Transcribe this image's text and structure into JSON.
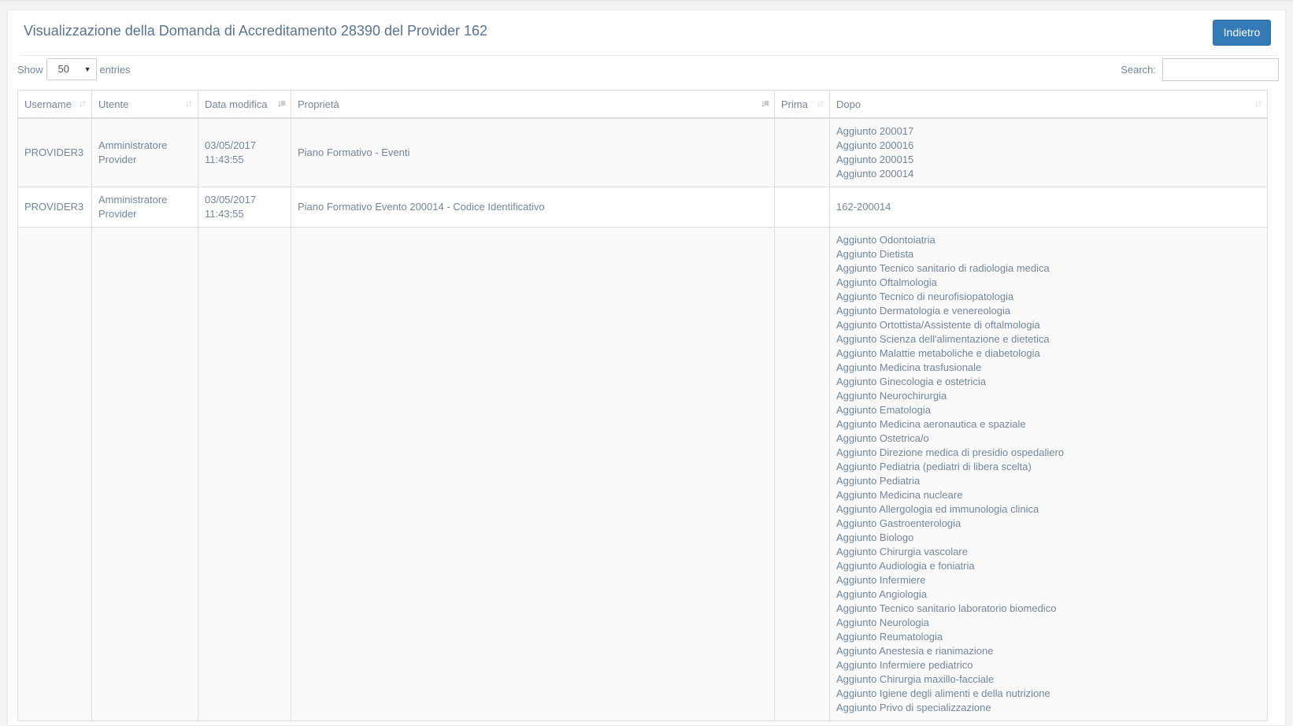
{
  "page": {
    "title": "Visualizzazione della Domanda di Accreditamento 28390 del Provider 162",
    "back_label": "Indietro"
  },
  "controls": {
    "show_label": "Show",
    "entries_value": "50",
    "entries_label": "entries",
    "search_label": "Search:",
    "search_value": ""
  },
  "table": {
    "columns": [
      "Username",
      "Utente",
      "Data modifica",
      "Proprietà",
      "Prima",
      "Dopo"
    ],
    "rows": [
      {
        "username": "PROVIDER3",
        "utente": "Amministratore Provider",
        "data": "03/05/2017 11:43:55",
        "proprieta": "Piano Formativo - Eventi",
        "prima": "",
        "dopo": [
          "Aggiunto 200017",
          "Aggiunto 200016",
          "Aggiunto 200015",
          "Aggiunto 200014"
        ]
      },
      {
        "username": "PROVIDER3",
        "utente": "Amministratore Provider",
        "data": "03/05/2017 11:43:55",
        "proprieta": "Piano Formativo Evento 200014 - Codice Identificativo",
        "prima": "",
        "dopo": [
          "162-200014"
        ]
      },
      {
        "username": "",
        "utente": "",
        "data": "",
        "proprieta": "",
        "prima": "",
        "dopo": [
          "Aggiunto Odontoiatria",
          "Aggiunto Dietista",
          "Aggiunto Tecnico sanitario di radiologia medica",
          "Aggiunto Oftalmologia",
          "Aggiunto Tecnico di neurofisiopatologia",
          "Aggiunto Dermatologia e venereologia",
          "Aggiunto Ortottista/Assistente di oftalmologia",
          "Aggiunto Scienza dell'alimentazione e dietetica",
          "Aggiunto Malattie metaboliche e diabetologia",
          "Aggiunto Medicina trasfusionale",
          "Aggiunto Ginecologia e ostetricia",
          "Aggiunto Neurochirurgia",
          "Aggiunto Ematologia",
          "Aggiunto Medicina aeronautica e spaziale",
          "Aggiunto Ostetrica/o",
          "Aggiunto Direzione medica di presidio ospedaliero",
          "Aggiunto Pediatria (pediatri di libera scelta)",
          "Aggiunto Pediatria",
          "Aggiunto Medicina nucleare",
          "Aggiunto Allergologia ed immunologia clinica",
          "Aggiunto Gastroenterologia",
          "Aggiunto Biologo",
          "Aggiunto Chirurgia vascolare",
          "Aggiunto Audiologia e foniatria",
          "Aggiunto Infermiere",
          "Aggiunto Angiologia",
          "Aggiunto Tecnico sanitario laboratorio biomedico",
          "Aggiunto Neurologia",
          "Aggiunto Reumatologia",
          "Aggiunto Anestesia e rianimazione",
          "Aggiunto Infermiere pediatrico",
          "Aggiunto Chirurgia maxillo-facciale",
          "Aggiunto Igiene degli alimenti e della nutrizione",
          "Aggiunto Privo di specializzazione"
        ]
      }
    ]
  },
  "icons": {
    "sort": "sort-both-icon",
    "sort_desc": "sort-desc-icon",
    "sort_asc": "sort-asc-icon",
    "caret": "chevron-down-icon"
  },
  "colors": {
    "primary_button": "#337ab7",
    "text": "#73879c",
    "title": "#5a738e",
    "stripe": "#f9f9f9",
    "border": "#dddddd"
  }
}
